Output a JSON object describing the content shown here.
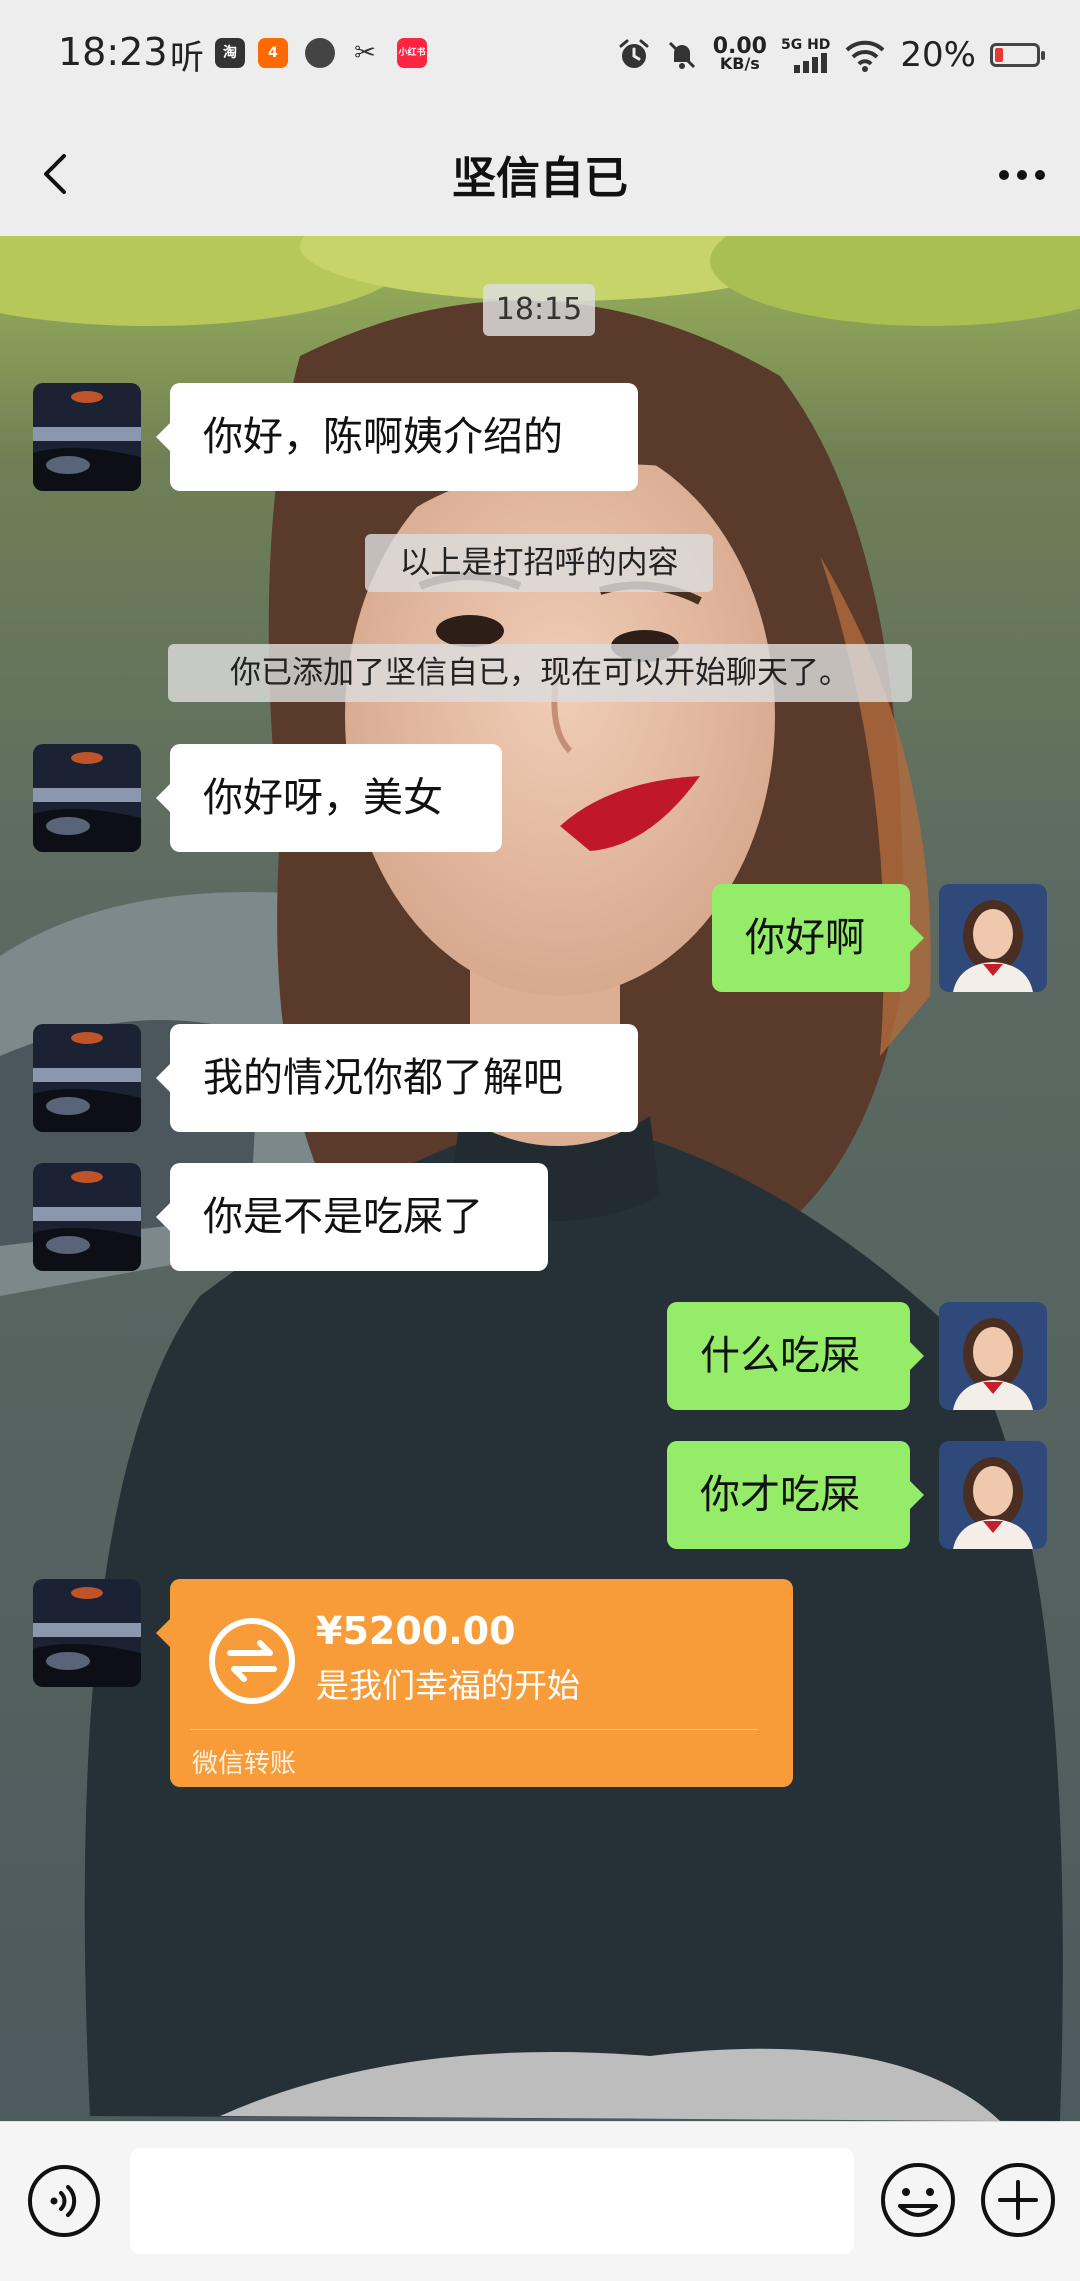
{
  "status_bar": {
    "time": "18:23",
    "ting_label": "听",
    "app_badges": [
      "淘",
      "4",
      "",
      "",
      "小红书"
    ],
    "net_speed_value": "0.00",
    "net_speed_unit": "KB/s",
    "network": "5G HD",
    "battery_percent": "20%",
    "battery_level": 0.2
  },
  "nav": {
    "title": "坚信自已",
    "back_icon": "chevron-left-icon",
    "more_icon": "more-horizontal-icon"
  },
  "chat": {
    "timestamp": "18:15",
    "messages": [
      {
        "side": "in",
        "text": "你好，陈啊姨介绍的"
      },
      {
        "type": "system",
        "text": "以上是打招呼的内容"
      },
      {
        "type": "system",
        "text": "你已添加了坚信自已，现在可以开始聊天了。"
      },
      {
        "side": "in",
        "text": "你好呀，美女"
      },
      {
        "side": "out",
        "text": "你好啊"
      },
      {
        "side": "in",
        "text": "我的情况你都了解吧"
      },
      {
        "side": "in",
        "text": "你是不是吃屎了"
      },
      {
        "side": "out",
        "text": "什么吃屎"
      },
      {
        "side": "out",
        "text": "你才吃屎"
      }
    ],
    "transfer": {
      "amount": "¥5200.00",
      "note": "是我们幸福的开始",
      "label": "微信转账",
      "color": "#f79c38"
    }
  },
  "input_bar": {
    "voice_icon": "voice-icon",
    "text_value": "",
    "emoji_icon": "emoji-icon",
    "plus_icon": "plus-icon"
  },
  "colors": {
    "outgoing_bubble": "#95ec69",
    "incoming_bubble": "#ffffff",
    "bar_background": "#ededed"
  }
}
